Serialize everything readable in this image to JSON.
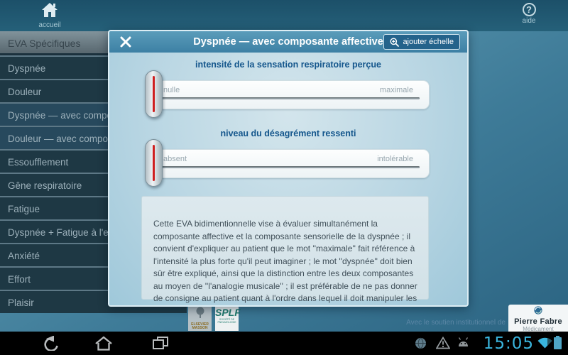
{
  "top_bar": {
    "home": {
      "label": "accueil"
    },
    "help": {
      "label": "aide",
      "icon_glyph": "?"
    }
  },
  "sidebar": {
    "header": "EVA Spécifiques",
    "items": [
      {
        "label": "Dyspnée",
        "selected": false
      },
      {
        "label": "Douleur",
        "selected": false
      },
      {
        "label": "Dyspnée — avec composante affective",
        "selected": true
      },
      {
        "label": "Douleur — avec composante affective",
        "selected": true
      },
      {
        "label": "Essoufflement",
        "selected": false
      },
      {
        "label": "Gêne respiratoire",
        "selected": false
      },
      {
        "label": "Fatigue",
        "selected": false
      },
      {
        "label": "Dyspnée + Fatigue à l'effort",
        "selected": false
      },
      {
        "label": "Anxiété",
        "selected": false
      },
      {
        "label": "Effort",
        "selected": false
      },
      {
        "label": "Plaisir",
        "selected": false
      }
    ]
  },
  "modal": {
    "title": "Dyspnée — avec composante affective",
    "close_glyph": "✕",
    "add_button_label": "ajouter échelle",
    "scales": [
      {
        "title": "intensité de la sensation respiratoire perçue",
        "min": "nulle",
        "max": "maximale",
        "cursor_position": "0"
      },
      {
        "title": "niveau du désagrément ressenti",
        "min": "absent",
        "max": "intolérable",
        "cursor_position": "0"
      }
    ],
    "description": "Cette EVA bidimentionnelle vise à évaluer simultanément la composante affective et la composante sensorielle de la dyspnée ; il convient d'expliquer au patient que le mot ''maximale'' fait référence à l'intensité la plus forte qu'il peut imaginer ; le mot ''dyspnée'' doit bien sûr être expliqué, ainsi que la distinction entre les deux composantes au moyen de ''l'analogie musicale'' ; il est préférable de ne pas donner de consigne au patient quant à l'ordre dans lequel il doit manipuler les deux curseurs."
  },
  "footer": {
    "support_text": "Avec le soutien institutionnel de",
    "elsevier": {
      "line1": "ELSEVIER",
      "line2": "MASSON"
    },
    "splf": {
      "name": "SPLF",
      "caption": "SOCIÉTÉ DE PNEUMOLOGIE"
    },
    "pierre_fabre": {
      "name": "Pierre Fabre",
      "sub": "Médicament"
    }
  },
  "nav_bar": {
    "time": "15:05"
  },
  "colors": {
    "holo_blue": "#33b5e5",
    "top_bar": "#1c5069",
    "modal_header": "#4a8fb0",
    "section_title": "#14568c",
    "slider_red": "#cf1f1f",
    "sidebar_bg": "#1e3844",
    "sidebar_selected": "#27495d"
  }
}
